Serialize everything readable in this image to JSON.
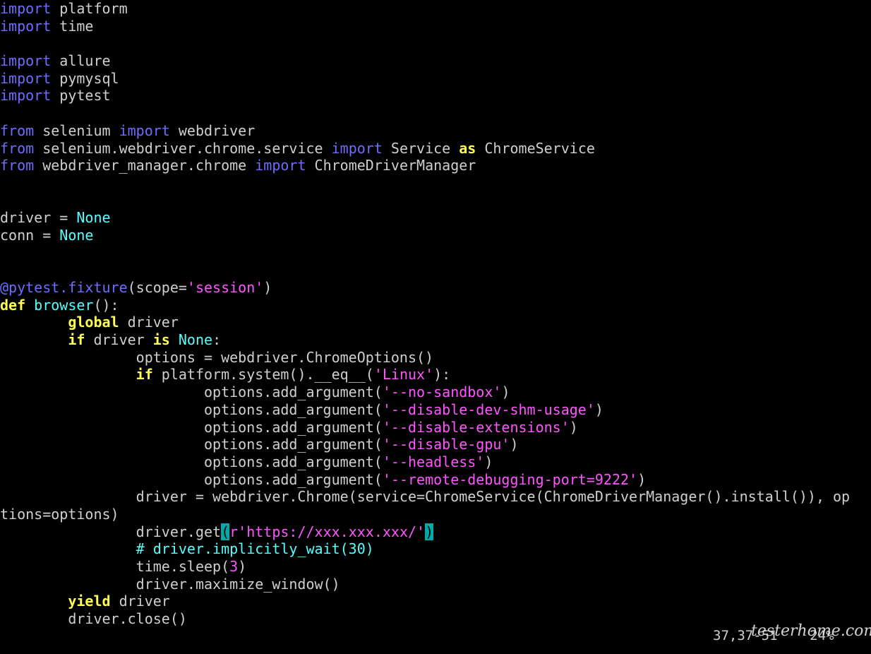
{
  "editor": {
    "lines": [
      [
        {
          "t": "import",
          "c": "kw"
        },
        {
          "t": " platform",
          "c": ""
        }
      ],
      [
        {
          "t": "import",
          "c": "kw"
        },
        {
          "t": " time",
          "c": ""
        }
      ],
      [],
      [
        {
          "t": "import",
          "c": "kw"
        },
        {
          "t": " allure",
          "c": ""
        }
      ],
      [
        {
          "t": "import",
          "c": "kw"
        },
        {
          "t": " pymysql",
          "c": ""
        }
      ],
      [
        {
          "t": "import",
          "c": "kw"
        },
        {
          "t": " pytest",
          "c": ""
        }
      ],
      [],
      [
        {
          "t": "from",
          "c": "kw"
        },
        {
          "t": " selenium ",
          "c": ""
        },
        {
          "t": "import",
          "c": "kw"
        },
        {
          "t": " webdriver",
          "c": ""
        }
      ],
      [
        {
          "t": "from",
          "c": "kw"
        },
        {
          "t": " selenium.webdriver.chrome.service ",
          "c": ""
        },
        {
          "t": "import",
          "c": "kw"
        },
        {
          "t": " Service ",
          "c": ""
        },
        {
          "t": "as",
          "c": "y"
        },
        {
          "t": " ChromeService",
          "c": ""
        }
      ],
      [
        {
          "t": "from",
          "c": "kw"
        },
        {
          "t": " webdriver_manager.chrome ",
          "c": ""
        },
        {
          "t": "import",
          "c": "kw"
        },
        {
          "t": " ChromeDriverManager",
          "c": ""
        }
      ],
      [],
      [],
      [
        {
          "t": "driver = ",
          "c": ""
        },
        {
          "t": "None",
          "c": "cy"
        }
      ],
      [
        {
          "t": "conn = ",
          "c": ""
        },
        {
          "t": "None",
          "c": "cy"
        }
      ],
      [],
      [],
      [
        {
          "t": "@pytest.fixture",
          "c": "deco"
        },
        {
          "t": "(scope=",
          "c": ""
        },
        {
          "t": "'session'",
          "c": "str"
        },
        {
          "t": ")",
          "c": ""
        }
      ],
      [
        {
          "t": "def",
          "c": "y"
        },
        {
          "t": " ",
          "c": ""
        },
        {
          "t": "browser",
          "c": "cy"
        },
        {
          "t": "():",
          "c": ""
        }
      ],
      [
        {
          "t": "        ",
          "c": ""
        },
        {
          "t": "global",
          "c": "y"
        },
        {
          "t": " driver",
          "c": ""
        }
      ],
      [
        {
          "t": "        ",
          "c": ""
        },
        {
          "t": "if",
          "c": "y"
        },
        {
          "t": " driver ",
          "c": ""
        },
        {
          "t": "is",
          "c": "y"
        },
        {
          "t": " ",
          "c": ""
        },
        {
          "t": "None",
          "c": "cy"
        },
        {
          "t": ":",
          "c": ""
        }
      ],
      [
        {
          "t": "                options = webdriver.ChromeOptions()",
          "c": ""
        }
      ],
      [
        {
          "t": "                ",
          "c": ""
        },
        {
          "t": "if",
          "c": "y"
        },
        {
          "t": " platform.system().__eq__(",
          "c": ""
        },
        {
          "t": "'Linux'",
          "c": "str"
        },
        {
          "t": "):",
          "c": ""
        }
      ],
      [
        {
          "t": "                        options.add_argument(",
          "c": ""
        },
        {
          "t": "'--no-sandbox'",
          "c": "str"
        },
        {
          "t": ")",
          "c": ""
        }
      ],
      [
        {
          "t": "                        options.add_argument(",
          "c": ""
        },
        {
          "t": "'--disable-dev-shm-usage'",
          "c": "str"
        },
        {
          "t": ")",
          "c": ""
        }
      ],
      [
        {
          "t": "                        options.add_argument(",
          "c": ""
        },
        {
          "t": "'--disable-extensions'",
          "c": "str"
        },
        {
          "t": ")",
          "c": ""
        }
      ],
      [
        {
          "t": "                        options.add_argument(",
          "c": ""
        },
        {
          "t": "'--disable-gpu'",
          "c": "str"
        },
        {
          "t": ")",
          "c": ""
        }
      ],
      [
        {
          "t": "                        options.add_argument(",
          "c": ""
        },
        {
          "t": "'--headless'",
          "c": "str"
        },
        {
          "t": ")",
          "c": ""
        }
      ],
      [
        {
          "t": "                        options.add_argument(",
          "c": ""
        },
        {
          "t": "'--remote-debugging-port=9222'",
          "c": "str"
        },
        {
          "t": ")",
          "c": ""
        }
      ],
      [
        {
          "t": "                driver = webdriver.Chrome(service=ChromeService(ChromeDriverManager().install()), op",
          "c": ""
        }
      ],
      [
        {
          "t": "tions=options)",
          "c": ""
        }
      ],
      [
        {
          "t": "                driver.get",
          "c": ""
        },
        {
          "t": "(",
          "c": "br"
        },
        {
          "t": "r'https://xxx.xxx.xxx/'",
          "c": "str"
        },
        {
          "t": ")",
          "c": "br"
        }
      ],
      [
        {
          "t": "                ",
          "c": ""
        },
        {
          "t": "# driver.implicitly_wait(30)",
          "c": "cy"
        }
      ],
      [
        {
          "t": "                time.sleep(",
          "c": ""
        },
        {
          "t": "3",
          "c": "num"
        },
        {
          "t": ")",
          "c": ""
        }
      ],
      [
        {
          "t": "                driver.maximize_window()",
          "c": ""
        }
      ],
      [
        {
          "t": "        ",
          "c": ""
        },
        {
          "t": "yield",
          "c": "y"
        },
        {
          "t": " driver",
          "c": ""
        }
      ],
      [
        {
          "t": "        driver.close()",
          "c": ""
        }
      ]
    ]
  },
  "statusline": {
    "ruler": "37,37-51",
    "percent": "24%"
  },
  "watermark": {
    "text": "testerhome.com"
  }
}
